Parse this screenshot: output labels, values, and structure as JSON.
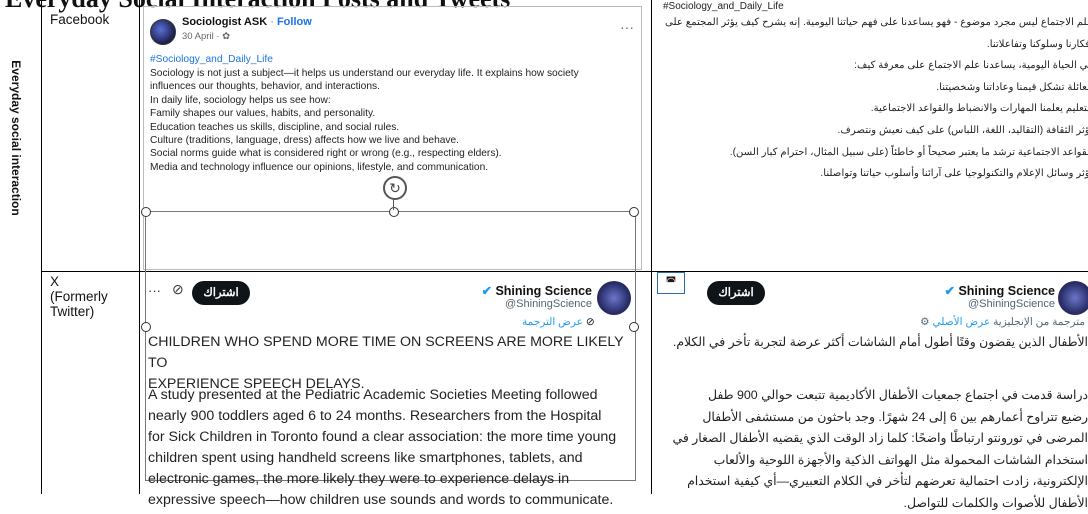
{
  "title": "Everyday Social Interaction Posts and Tweets",
  "side_label": "Everyday social interaction",
  "rows": [
    {
      "platform": "Facebook"
    },
    {
      "platform": "X (Formerly Twitter)"
    }
  ],
  "facebook_post": {
    "author": "Sociologist ASK",
    "follow": "Follow",
    "date": "30 April",
    "hashtag": "#Sociology_and_Daily_Life",
    "lines": [
      "Sociology is not just a subject—it helps us understand our everyday life. It explains how society",
      "influences our thoughts, behavior, and interactions.",
      "In daily life, sociology helps us see how:",
      "Family shapes our values, habits, and personality.",
      "Education teaches us skills, discipline, and social rules.",
      "Culture (traditions, language, dress) affects how we live and behave.",
      "Social norms guide what is considered right or wrong (e.g., respecting elders).",
      "Media and technology influence our opinions, lifestyle, and communication."
    ]
  },
  "facebook_post_ar": {
    "hashtag": "#Sociology_and_Daily_Life",
    "lines": [
      "علم الاجتماع ليس مجرد موضوع - فهو يساعدنا على فهم حياتنا اليومية. إنه يشرح كيف يؤثر المجتمع على",
      "أفكارنا وسلوكنا وتفاعلاتنا.",
      "في الحياة اليومية، يساعدنا علم الاجتماع على معرفة كيف:",
      "العائلة تشكل قيمنا وعاداتنا وشخصيتنا.",
      "التعليم يعلمنا المهارات والانضباط والقواعد الاجتماعية.",
      "تؤثر الثقافة (التقاليد، اللغة، اللباس) على كيف نعيش ونتصرف.",
      "القواعد الاجتماعية ترشد ما يعتبر صحيحاً أو خاطئاً (على سبيل المثال، احترام كبار السن).",
      "تؤثر وسائل الإعلام والتكنولوجيا على آرائنا وأسلوب حياتنا وتواصلنا."
    ]
  },
  "x_post": {
    "author": "Shining Science",
    "handle": "@ShiningScience",
    "subscribe": "اشتراك",
    "translation_link": "عرض الترجمة",
    "headline_lines": [
      "CHILDREN WHO SPEND MORE TIME ON SCREENS ARE MORE LIKELY TO",
      "EXPERIENCE SPEECH DELAYS."
    ],
    "body_lines": [
      "A study presented at the Pediatric Academic Societies Meeting followed",
      "nearly 900 toddlers aged 6 to 24 months. Researchers from the Hospital",
      "for Sick Children in Toronto found a clear association: the more time young",
      "children spent using handheld screens like smartphones, tablets, and",
      "electronic games, the more likely they were to experience delays in",
      "expressive speech—how children use sounds and words to communicate."
    ]
  },
  "x_post_ar": {
    "author": "Shining Science",
    "handle": "@ShiningScience",
    "subscribe": "اشتراك",
    "translated_note": "مترجمة من الإنجليزية",
    "show_original": "عرض الأصلي",
    "headline": "الأطفال الذين يقضون وقتًا أطول أمام الشاشات أكثر عرضة لتجربة تأخر في الكلام.",
    "body_lines": [
      "دراسة قدمت في اجتماع جمعيات الأطفال الأكاديمية تتبعت حوالي 900 طفل",
      "رضيع تتراوح أعمارهم بين 6 إلى 24 شهرًا. وجد باحثون من مستشفى الأطفال",
      "المرضى في تورونتو ارتباطًا واضحًا: كلما زاد الوقت الذي يقضيه الأطفال الصغار في",
      "استخدام الشاشات المحمولة مثل الهواتف الذكية والأجهزة اللوحية والألعاب",
      "الإلكترونية، زادت احتمالية تعرضهم لتأخر في الكلام التعبيري—أي كيفية استخدام",
      "الأطفال للأصوات والكلمات للتواصل."
    ]
  }
}
